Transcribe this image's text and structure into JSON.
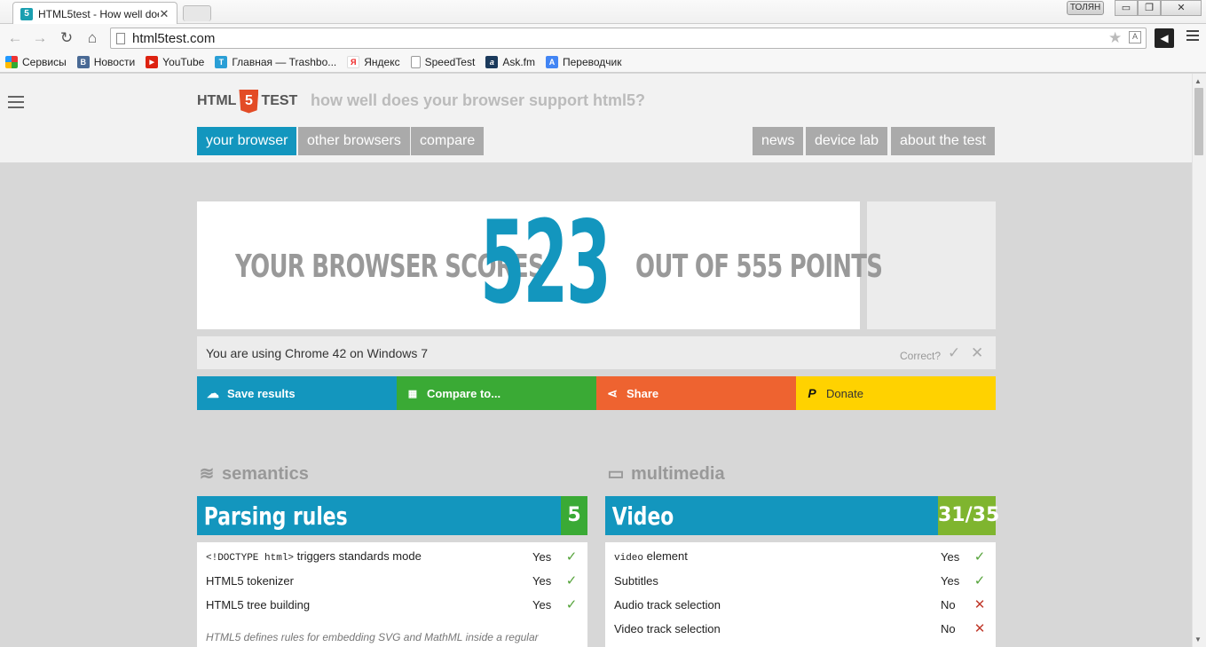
{
  "browser": {
    "tab_title": "HTML5test - How well doe",
    "tab_favicon": "5",
    "close_glyph": "✕",
    "user_badge": "ТОЛЯН",
    "window_controls": {
      "minimize": "▭",
      "restore": "❐",
      "close": "✕"
    },
    "url": "html5test.com",
    "bookmarks": [
      {
        "label": "Сервисы",
        "icon": "apps-grid-icon"
      },
      {
        "label": "Новости",
        "icon": "vk-icon",
        "glyph": "B"
      },
      {
        "label": "YouTube",
        "icon": "youtube-icon",
        "glyph": "▶"
      },
      {
        "label": "Главная — Trashbo...",
        "icon": "trashbox-icon",
        "glyph": "T"
      },
      {
        "label": "Яндекс",
        "icon": "yandex-icon",
        "glyph": "Я"
      },
      {
        "label": "SpeedTest",
        "icon": "page-icon",
        "glyph": ""
      },
      {
        "label": "Ask.fm",
        "icon": "askfm-icon",
        "glyph": "a"
      },
      {
        "label": "Переводчик",
        "icon": "translate-icon",
        "glyph": "A"
      }
    ]
  },
  "site": {
    "logo_left": "HTML",
    "logo_right": "TEST",
    "logo_glyph": "5",
    "tagline": "how well does your browser support html5?",
    "nav_left": [
      "your browser",
      "other browsers",
      "compare"
    ],
    "nav_right": [
      "news",
      "device lab",
      "about the test"
    ]
  },
  "score": {
    "prefix": "YOUR BROWSER SCORES",
    "value": "523",
    "suffix": "OUT OF 555 POINTS",
    "using": "You are using Chrome 42 on Windows 7",
    "correct": "Correct?"
  },
  "actions": {
    "save": "Save results",
    "compare": "Compare to...",
    "share": "Share",
    "donate": "Donate"
  },
  "colors": {
    "accent": "#1396be",
    "save": "#1396be",
    "compare": "#3aaa35",
    "share": "#ee6330",
    "donate": "#ffd200",
    "score_badge": "#7fb52f",
    "score_badge_full": "#3aaa35"
  },
  "sections": {
    "semantics": {
      "heading": "semantics",
      "title": "Parsing rules",
      "score": "5",
      "rows": [
        {
          "code": "<!DOCTYPE html>",
          "label": " triggers standards mode",
          "result": "Yes"
        },
        {
          "code": "",
          "label": "HTML5 tokenizer",
          "result": "Yes"
        },
        {
          "code": "",
          "label": "HTML5 tree building",
          "result": "Yes"
        }
      ],
      "note": "HTML5 defines rules for embedding SVG and MathML inside a regular"
    },
    "multimedia": {
      "heading": "multimedia",
      "title": "Video",
      "score": "31/35",
      "rows": [
        {
          "code": "video",
          "label": " element",
          "result": "Yes"
        },
        {
          "code": "",
          "label": "Subtitles",
          "result": "Yes"
        },
        {
          "code": "",
          "label": "Audio track selection",
          "result": "No"
        },
        {
          "code": "",
          "label": "Video track selection",
          "result": "No"
        }
      ]
    }
  },
  "marks": {
    "yes": "✓",
    "no": "✕"
  }
}
